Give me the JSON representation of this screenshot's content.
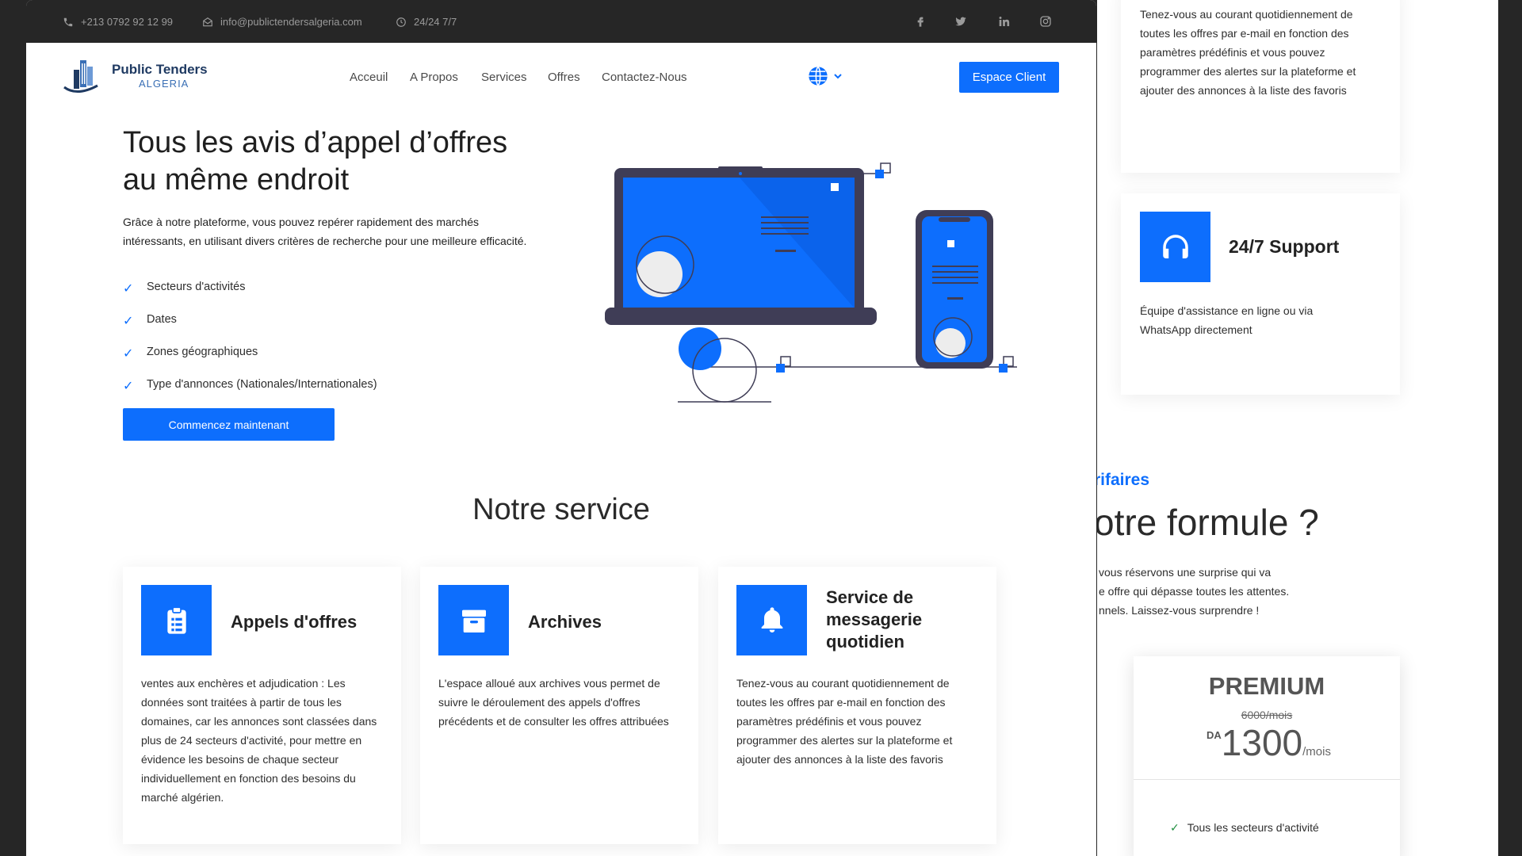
{
  "topbar": {
    "phone": "+213 0792 92 12 99",
    "email": "info@publictendersalgeria.com",
    "hours": "24/24 7/7",
    "social_icons": [
      "facebook-icon",
      "twitter-icon",
      "linkedin-icon",
      "instagram-icon"
    ]
  },
  "logo": {
    "line1": "Public Tenders",
    "line2": "ALGERIA"
  },
  "nav": {
    "items": [
      "Acceuil",
      "A Propos",
      "Services",
      "Offres",
      "Contactez-Nous"
    ],
    "language_icon": "globe-icon",
    "espace_client": "Espace Client"
  },
  "hero": {
    "title": "Tous les avis d’appel d’offres au même endroit",
    "description": "Grâce à notre plateforme, vous pouvez repérer rapidement des marchés intéressants, en utilisant divers critères de recherche pour une meilleure efficacité.",
    "checklist": [
      "Secteurs d'activités",
      "Dates",
      "Zones géographiques",
      "Type d'annonces (Nationales/Internationales)"
    ],
    "cta": "Commencez maintenant"
  },
  "services": {
    "title": "Notre service",
    "cards": [
      {
        "icon": "clipboard-list-icon",
        "title": "Appels d'offres",
        "description": "ventes aux enchères et adjudication : Les données sont traitées à partir de tous les domaines, car les annonces sont classées dans plus de 24 secteurs d'activité, pour mettre en évidence les besoins de chaque secteur individuellement en fonction des besoins du marché algérien."
      },
      {
        "icon": "archive-box-icon",
        "title": "Archives",
        "description": "L'espace alloué aux archives vous permet de suivre le déroulement des appels d'offres précédents et de consulter les offres attribuées"
      },
      {
        "icon": "bell-icon",
        "title": "Service de messagerie quotidien",
        "description": "Tenez-vous au courant quotidiennement de toutes les offres par e-mail en fonction des paramètres prédéfinis et vous pouvez programmer des alertes sur la plateforme et ajouter des annonces à la liste des favoris"
      }
    ]
  },
  "right_panel": {
    "messaging_excerpt": "Tenez-vous au courant quotidiennement de toutes les offres par e-mail en fonction des paramètres prédéfinis et vous pouvez programmer des alertes sur la plateforme et ajouter des annonces à la liste des favoris",
    "support": {
      "icon": "headphones-icon",
      "title": "24/7 Support",
      "description": "Équipe d'assistance en ligne ou via WhatsApp directement"
    },
    "pricing_eyebrow": "rifaires",
    "pricing_title": "otre formule ?",
    "pricing_lines": [
      "vous réservons une surprise qui va",
      "e offre qui dépasse toutes les attentes.",
      "nnels. Laissez-vous surprendre !"
    ],
    "plan": {
      "name": "PREMIUM",
      "old_price": "6000/mois",
      "currency": "DA",
      "price": "1300",
      "period": "/mois",
      "features": [
        "Tous les secteurs d'activité"
      ]
    }
  },
  "colors": {
    "accent": "#0d6efd",
    "dark_bar": "#262626",
    "illustration_dark": "#3f3d56"
  }
}
